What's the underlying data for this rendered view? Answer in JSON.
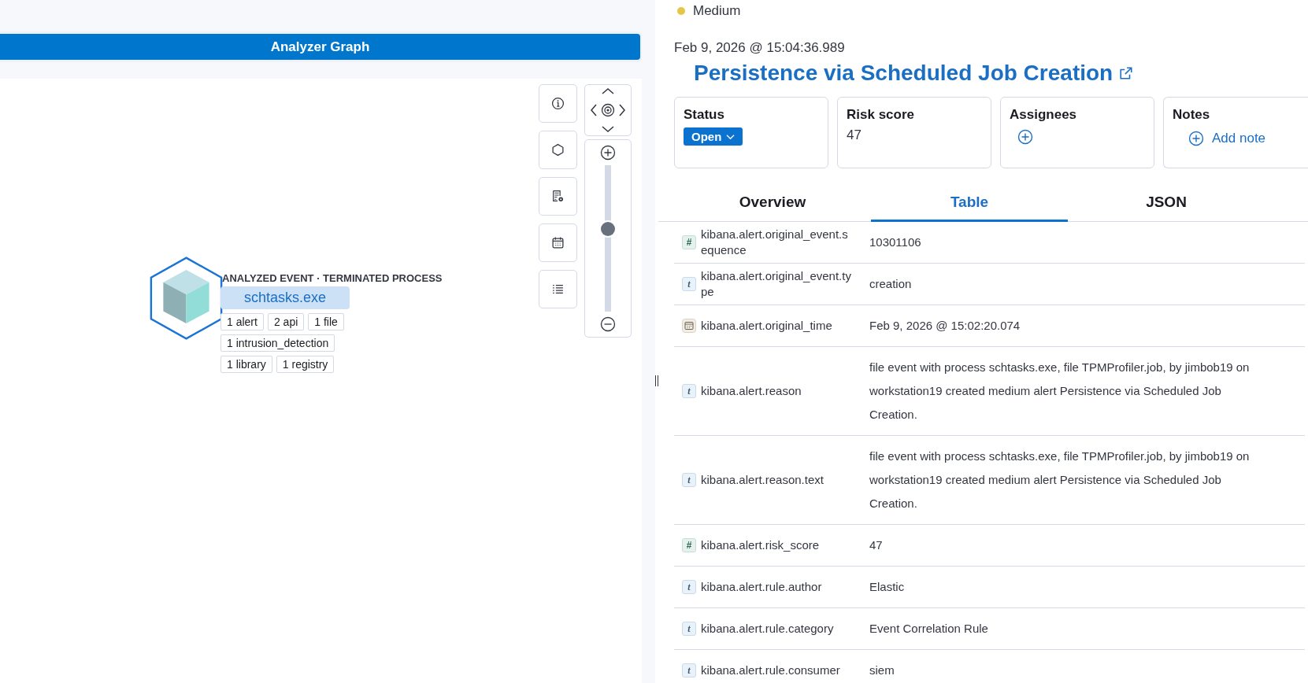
{
  "graph": {
    "title": "Analyzer Graph",
    "node": {
      "caption": "ANALYZED EVENT · TERMINATED PROCESS",
      "name": "schtasks.exe",
      "selected": true,
      "tag_rows": [
        {
          "tags": [
            "1 alert",
            "2 api",
            "1 file"
          ]
        },
        {
          "tags": [
            "1 intrusion_detection"
          ]
        },
        {
          "tags": [
            "1 library",
            "1 registry"
          ]
        }
      ]
    },
    "zoom": {
      "level": 0.57
    }
  },
  "alert": {
    "severity": {
      "label": "Medium",
      "kind": "medium"
    },
    "timestamp": "Feb 9, 2026 @ 15:04:36.989",
    "title": "Persistence via Scheduled Job Creation",
    "cards": [
      {
        "kind": "status",
        "heading": "Status",
        "value": "Open"
      },
      {
        "kind": "text",
        "heading": "Risk score",
        "value": "47"
      },
      {
        "kind": "assignees",
        "heading": "Assignees"
      },
      {
        "kind": "notes",
        "heading": "Notes",
        "action": "Add note"
      }
    ],
    "tabs": [
      {
        "label": "Overview",
        "selected": false
      },
      {
        "label": "Table",
        "selected": true
      },
      {
        "label": "JSON",
        "selected": false
      }
    ],
    "rows": [
      {
        "kind": "number",
        "badge": "#",
        "field": "kibana.alert.original_event.sequence",
        "value": "10301106"
      },
      {
        "kind": "string",
        "badge": "t",
        "field": "kibana.alert.original_event.type",
        "value": "creation"
      },
      {
        "kind": "date",
        "field": "kibana.alert.original_time",
        "value": "Feb 9, 2026 @ 15:02:20.074"
      },
      {
        "kind": "string",
        "badge": "t",
        "field": "kibana.alert.reason",
        "value": "file event with process schtasks.exe, file TPMProfiler.job, by jimbob19 on workstation19 created medium alert Persistence via Scheduled Job Creation."
      },
      {
        "kind": "string",
        "badge": "t",
        "field": "kibana.alert.reason.text",
        "value": "file event with process schtasks.exe, file TPMProfiler.job, by jimbob19 on workstation19 created medium alert Persistence via Scheduled Job Creation."
      },
      {
        "kind": "number",
        "badge": "#",
        "field": "kibana.alert.risk_score",
        "value": "47"
      },
      {
        "kind": "string",
        "badge": "t",
        "field": "kibana.alert.rule.author",
        "value": "Elastic"
      },
      {
        "kind": "string",
        "badge": "t",
        "field": "kibana.alert.rule.category",
        "value": "Event Correlation Rule"
      },
      {
        "kind": "string",
        "badge": "t",
        "field": "kibana.alert.rule.consumer",
        "value": "siem"
      }
    ]
  }
}
